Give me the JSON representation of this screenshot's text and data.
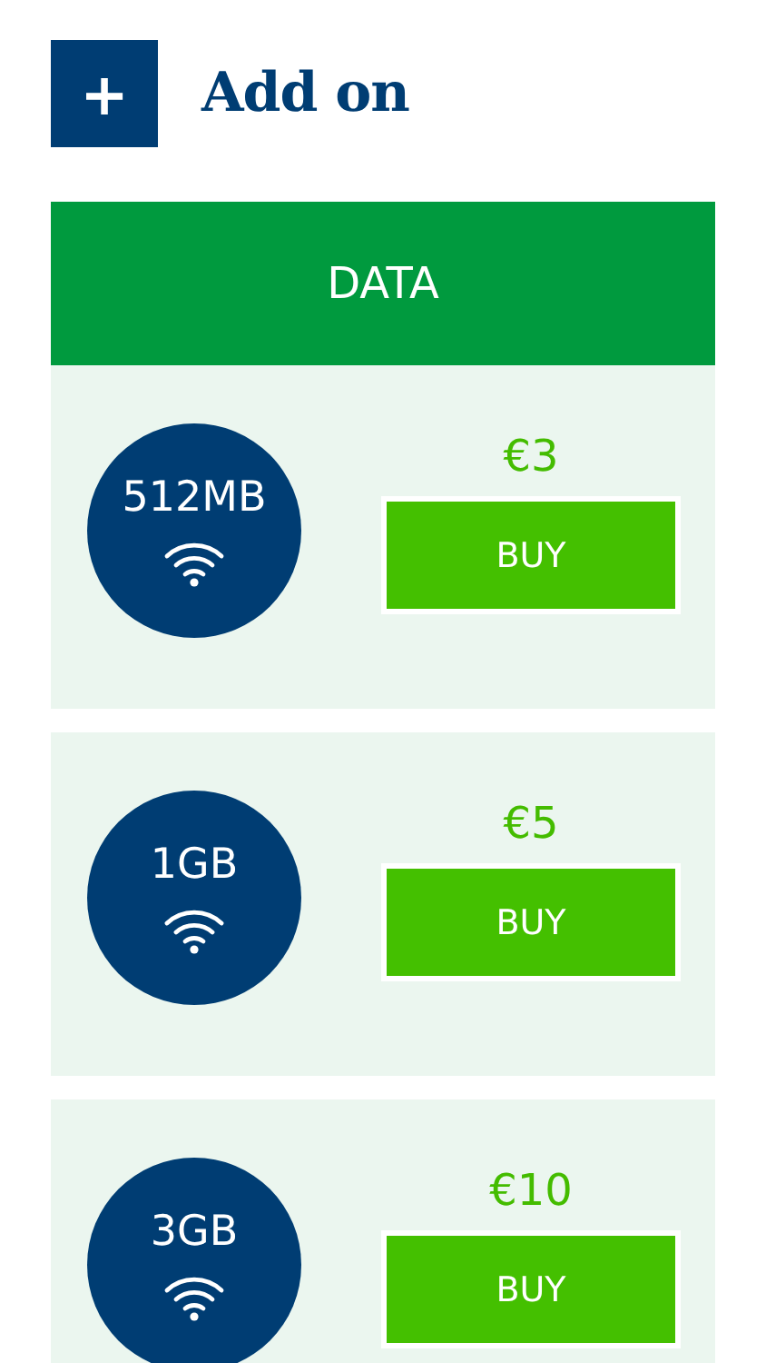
{
  "header": {
    "icon_text": "+",
    "title": "Add on"
  },
  "category": {
    "label": "DATA"
  },
  "offers": [
    {
      "amount": "512MB",
      "price": "€3",
      "button": "BUY"
    },
    {
      "amount": "1GB",
      "price": "€5",
      "button": "BUY"
    },
    {
      "amount": "3GB",
      "price": "€10",
      "button": "BUY"
    }
  ]
}
